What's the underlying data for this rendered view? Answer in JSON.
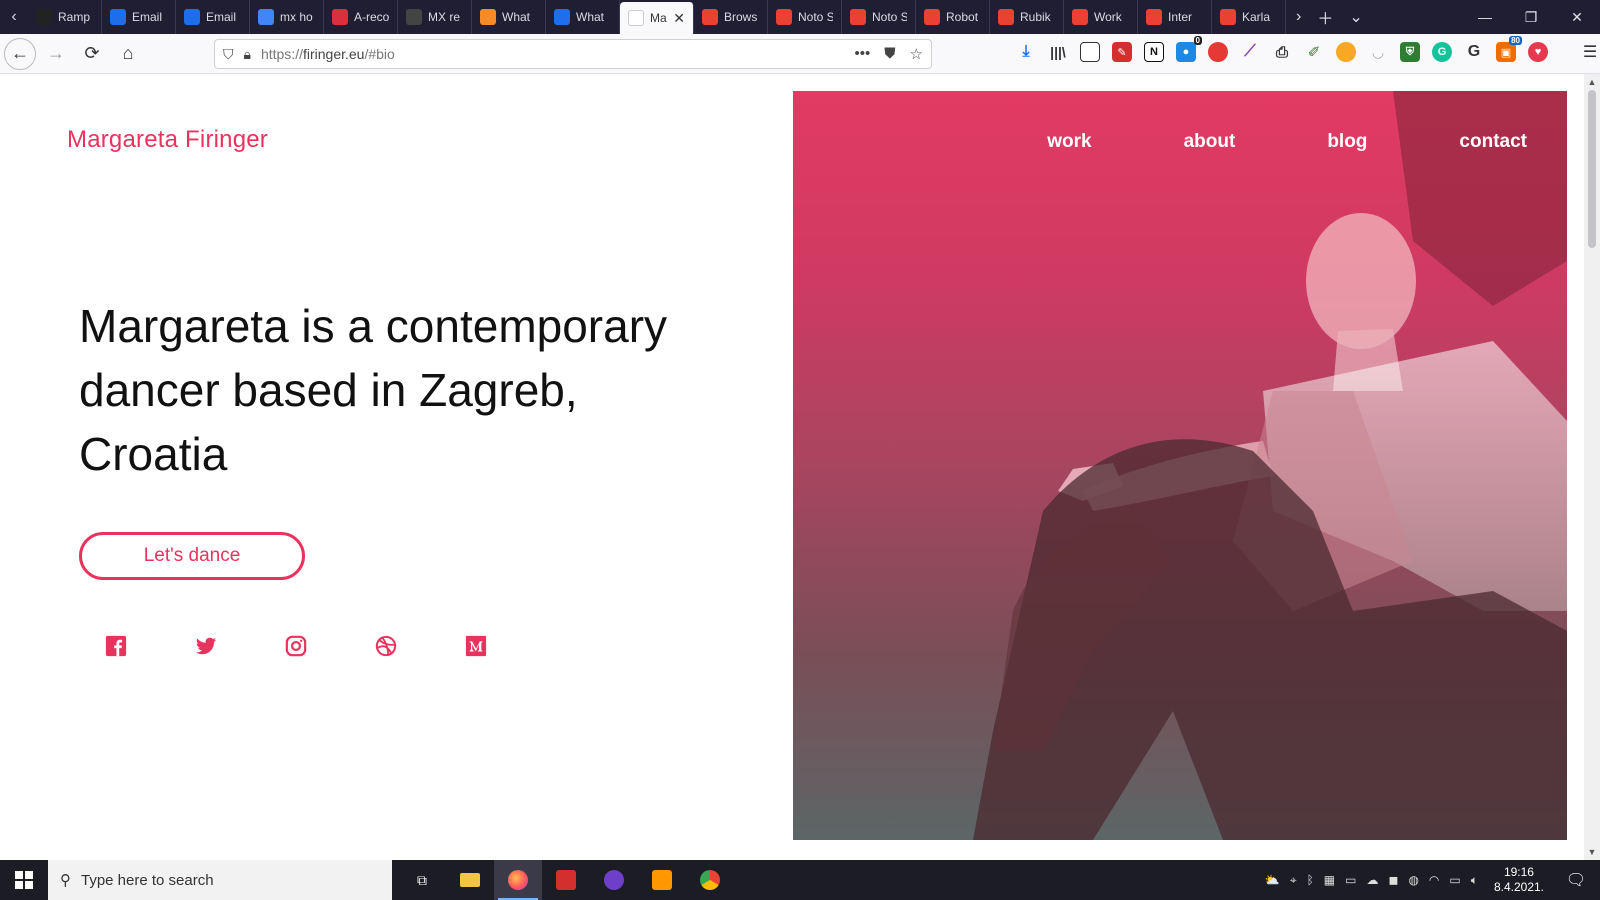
{
  "browser": {
    "tabs": [
      {
        "label": "Ramp",
        "fav_color": "#222222",
        "icon": "ramp-favicon"
      },
      {
        "label": "Email",
        "fav_color": "#1d6ee8",
        "icon": "d-favicon"
      },
      {
        "label": "Email",
        "fav_color": "#1d6ee8",
        "icon": "d-favicon"
      },
      {
        "label": "mx ho",
        "fav_color": "#4285f4",
        "icon": "google-favicon"
      },
      {
        "label": "A-reco",
        "fav_color": "#d9303c",
        "icon": "arecord-favicon"
      },
      {
        "label": "MX re",
        "fav_color": "#444444",
        "icon": "wikipedia-favicon"
      },
      {
        "label": "What",
        "fav_color": "#f28b28",
        "icon": "colorful-favicon"
      },
      {
        "label": "What",
        "fav_color": "#1f6feb",
        "icon": "blue-favicon"
      },
      {
        "label": "Margar",
        "fav_color": "#ffffff",
        "icon": "page-favicon",
        "active": true
      },
      {
        "label": "Brows",
        "fav_color": "#e94235",
        "icon": "fonts-favicon"
      },
      {
        "label": "Noto S",
        "fav_color": "#e94235",
        "icon": "fonts-favicon"
      },
      {
        "label": "Noto S",
        "fav_color": "#e94235",
        "icon": "fonts-favicon"
      },
      {
        "label": "Robot",
        "fav_color": "#e94235",
        "icon": "fonts-favicon"
      },
      {
        "label": "Rubik",
        "fav_color": "#e94235",
        "icon": "fonts-favicon"
      },
      {
        "label": "Work",
        "fav_color": "#e94235",
        "icon": "fonts-favicon"
      },
      {
        "label": "Inter",
        "fav_color": "#e94235",
        "icon": "fonts-favicon"
      },
      {
        "label": "Karla",
        "fav_color": "#e94235",
        "icon": "fonts-favicon"
      }
    ],
    "url_prefix": "https://",
    "url_host": "firinger.eu",
    "url_path": "/#bio"
  },
  "page": {
    "brand": "Margareta Firinger",
    "headline": "Margareta is a contemporary dancer based in Zagreb, Croatia",
    "cta": "Let's dance",
    "nav": [
      "work",
      "about",
      "blog",
      "contact"
    ],
    "socials": [
      "facebook-icon",
      "twitter-icon",
      "instagram-icon",
      "dribbble-icon",
      "medium-icon"
    ],
    "accent": "#e8335f"
  },
  "taskbar": {
    "search_placeholder": "Type here to search",
    "time": "19:16",
    "date": "8.4.2021."
  }
}
